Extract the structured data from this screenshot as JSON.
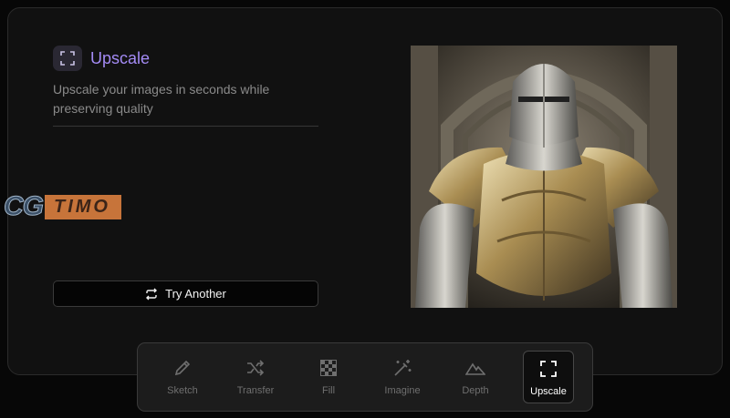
{
  "feature": {
    "title": "Upscale",
    "description": "Upscale your images in seconds while preserving quality",
    "icon": "expand-corners-icon",
    "accent_color": "#a48bf5"
  },
  "actions": {
    "try_another_label": "Try Another",
    "try_another_icon": "repeat-icon"
  },
  "preview_image": {
    "subject": "armored-knight-image"
  },
  "watermark": {
    "part1": "CG",
    "part2": "TIMO"
  },
  "toolbar": {
    "tools": [
      {
        "label": "Sketch",
        "icon": "pencil-icon"
      },
      {
        "label": "Transfer",
        "icon": "shuffle-icon"
      },
      {
        "label": "Fill",
        "icon": "checker-icon"
      },
      {
        "label": "Imagine",
        "icon": "magic-wand-icon"
      },
      {
        "label": "Depth",
        "icon": "mountain-icon"
      },
      {
        "label": "Upscale",
        "icon": "expand-corners-icon",
        "active": true
      }
    ]
  }
}
